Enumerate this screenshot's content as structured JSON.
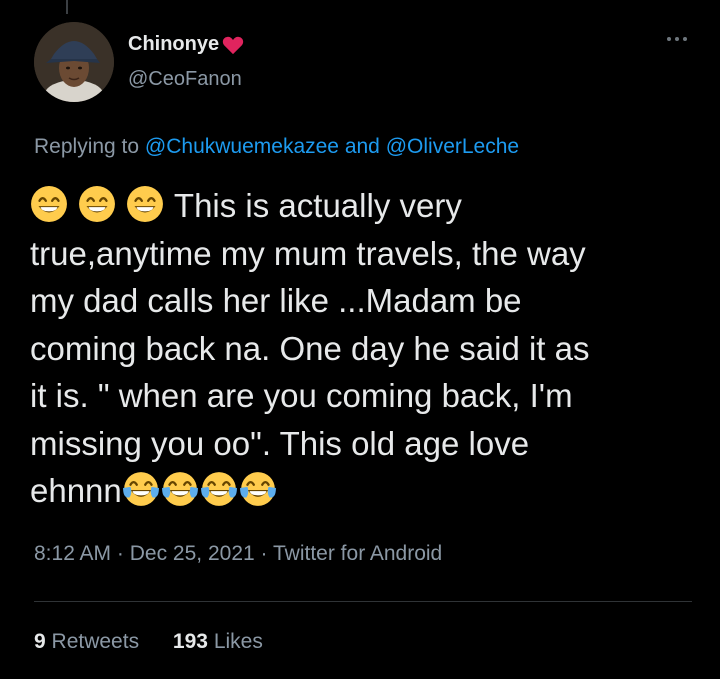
{
  "author": {
    "name": "Chinonye",
    "handle": "@CeoFanon",
    "name_emoji": "red-heart-icon"
  },
  "reply": {
    "prefix": "Replying to",
    "user1": "@Chukwuemekazee",
    "and_text": "and",
    "user2": "@OliverLeche"
  },
  "tweet": {
    "lines": [
      "This is actually very",
      "true,anytime my mum travels, the way",
      "my dad calls her like ...Madam be",
      "coming back na. One day he said it as",
      "it is. \" when are you coming back, I'm",
      "missing you oo\". This old age love",
      "ehnnn"
    ],
    "leading_emojis": [
      "grinning-face-with-smiling-eyes-icon",
      "grinning-face-with-smiling-eyes-icon",
      "grinning-face-with-smiling-eyes-icon"
    ],
    "trailing_emojis": [
      "face-with-tears-of-joy-icon",
      "face-with-tears-of-joy-icon",
      "face-with-tears-of-joy-icon",
      "face-with-tears-of-joy-icon"
    ]
  },
  "meta": {
    "time": "8:12 AM",
    "sep1": "·",
    "date": "Dec 25, 2021",
    "sep2": "·",
    "source": "Twitter for Android"
  },
  "stats": {
    "retweets_count": "9",
    "retweets_label": "Retweets",
    "likes_count": "193",
    "likes_label": "Likes"
  },
  "colors": {
    "background": "#000000",
    "text": "#e7e9ea",
    "secondary": "#8b98a5",
    "link": "#1d9bf0",
    "heart": "#e0245e"
  }
}
